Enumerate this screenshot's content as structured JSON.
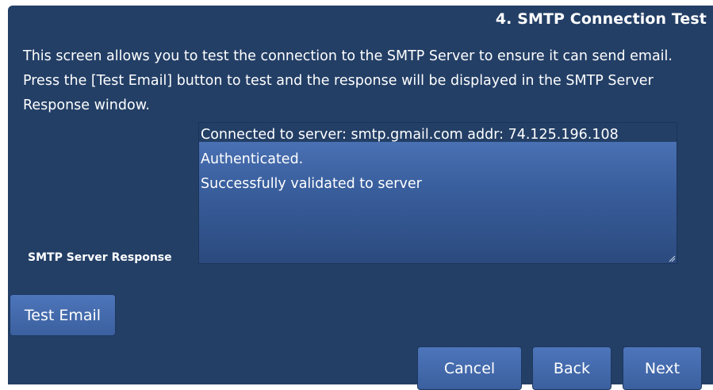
{
  "page": {
    "step_title": "4. SMTP Connection Test",
    "description": "This screen allows you to test the connection to the SMTP Server to ensure it can send email. Press the [Test Email] button to test and the response will be displayed in the SMTP Server Response window."
  },
  "response": {
    "label": "SMTP Server Response",
    "lines": [
      "Connected to server: smtp.gmail.com addr: 74.125.196.108",
      "Authenticated.",
      "Successfully validated to server"
    ]
  },
  "buttons": {
    "test_email": "Test Email",
    "cancel": "Cancel",
    "back": "Back",
    "next": "Next"
  },
  "colors": {
    "panel_background": "#233f66",
    "button_background": "#4466aa",
    "text": "#ffffff"
  }
}
